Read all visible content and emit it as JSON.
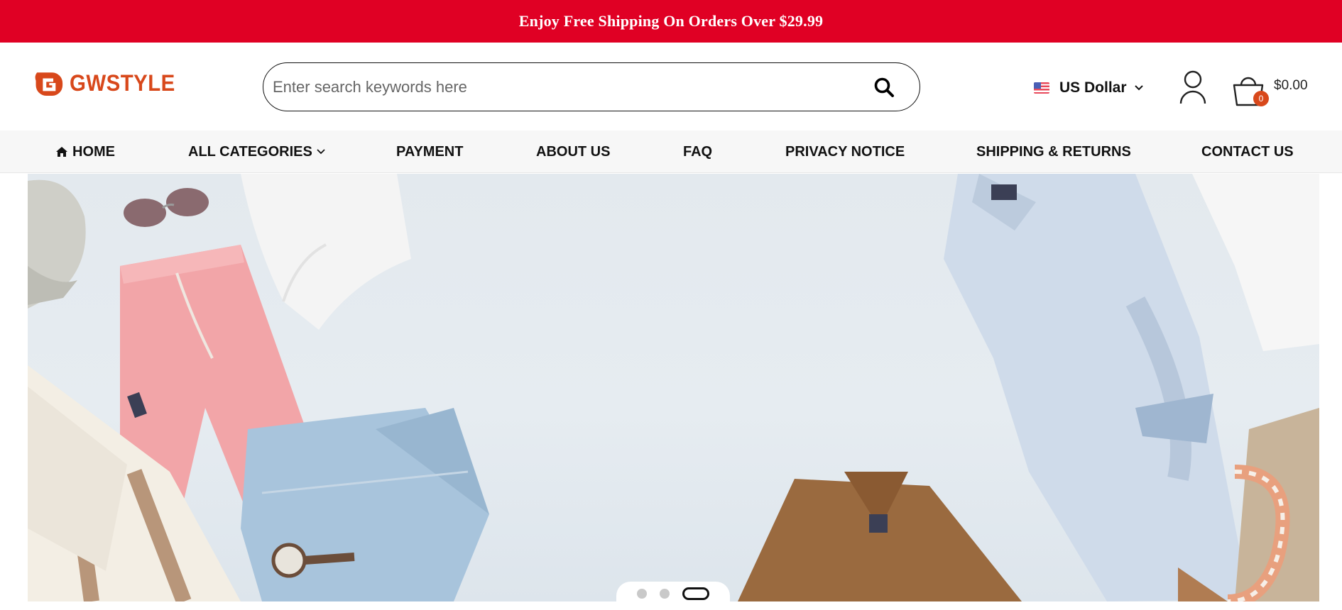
{
  "announcement": {
    "text": "Enjoy Free Shipping On Orders Over $29.99",
    "bg_color": "#e00024"
  },
  "header": {
    "logo_text": "GWSTYLE",
    "brand_color": "#d8481b",
    "search": {
      "placeholder": "Enter search keywords here"
    },
    "currency": {
      "label": "US Dollar",
      "flag": "us-flag-icon"
    },
    "cart": {
      "count": "0",
      "total": "$0.00"
    }
  },
  "nav": {
    "items": [
      {
        "label": "HOME",
        "icon": "home-icon"
      },
      {
        "label": "ALL CATEGORIES",
        "dropdown": true
      },
      {
        "label": "PAYMENT"
      },
      {
        "label": "ABOUT US"
      },
      {
        "label": "FAQ"
      },
      {
        "label": "PRIVACY NOTICE"
      },
      {
        "label": "SHIPPING & RETURNS"
      },
      {
        "label": "CONTACT US"
      }
    ]
  },
  "hero": {
    "slide_count": 3,
    "active_slide": 3
  }
}
